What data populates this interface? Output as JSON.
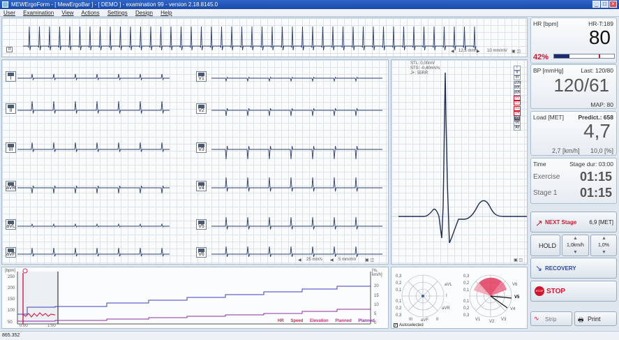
{
  "window": {
    "title": "MEWErgoForm - [ MewErgoBar ] - [ DEMO ] - examination 99 - version 2.18.8145.0",
    "min": "_",
    "max": "□",
    "close": "×"
  },
  "menu": [
    "User",
    "Examination",
    "View",
    "Actions",
    "Settings",
    "Design",
    "Help"
  ],
  "rhythm": {
    "lead": "II",
    "speed": "12,5 mm/s",
    "gain": "10 mm/mV"
  },
  "leads_left": [
    "I",
    "II",
    "III",
    "aVR",
    "aVL",
    "aVF"
  ],
  "leads_right": [
    "V1",
    "V2",
    "V3",
    "V4",
    "V5",
    "V6"
  ],
  "ecg_footer": {
    "speed": "25 mm/s",
    "gain": "5 mm/mV"
  },
  "avg": {
    "stl": "STL: 0,00mV",
    "sts": "STS: -0,40mV/s",
    "jx": "J+: 55RR",
    "leads": [
      "I",
      "II",
      "III",
      "aVR",
      "aVL",
      "aVF",
      "V1",
      "V2",
      "V3",
      "V4",
      "V5",
      "V6",
      "All"
    ]
  },
  "trend": {
    "yleft_unit": "[bpm]",
    "yright_unit": "[%, km/h]",
    "yleft_ticks": [
      "250",
      "200",
      "150",
      "100",
      "50"
    ],
    "yright_ticks": [
      "20",
      "15",
      "10",
      "5",
      "0"
    ],
    "x_ticks": [
      "0:00",
      "1:00"
    ],
    "legend": [
      "HR",
      "Speed",
      "Elevation",
      "Planned",
      "Planned"
    ],
    "legend_colors": [
      "#d6284e",
      "#d6284e",
      "#c62e7a",
      "#3b3ec0",
      "#8a2f9a"
    ]
  },
  "polar": {
    "left_labels": [
      "0,3",
      "0,2",
      "0,1",
      "0,1",
      "0,2",
      "0,3"
    ],
    "right_labels": [
      "0,3",
      "0,2",
      "0,1",
      "0,1",
      "0,2",
      "0,3"
    ],
    "leads_left": [
      "I",
      "aVL",
      "aVR",
      "aVF",
      "III",
      "II"
    ],
    "leads_right": [
      "V1",
      "V2",
      "V3",
      "V4",
      "V5",
      "V6"
    ],
    "autoselected": "Autoselected"
  },
  "hr": {
    "label": "HR [bpm]",
    "target": "HR-T:189",
    "value": "80",
    "percent": "42%"
  },
  "bp": {
    "label": "BP [mmHg]",
    "last": "Last: 120/80",
    "value": "120/61",
    "map": "MAP: 80"
  },
  "load": {
    "label": "Load [MET]",
    "predict": "Predict.: 658",
    "value": "4,7",
    "speed": "2,7 [km/h]",
    "elevation": "10,0 [%]"
  },
  "time": {
    "label": "Time",
    "stage_dur": "Stage dur: 03:00",
    "exercise_label": "Exercise",
    "exercise": "01:15",
    "stage_label": "Stage 1",
    "stage": "01:15"
  },
  "next": {
    "label": "NEXT Stage",
    "met": "6,9 [MET]"
  },
  "hold": {
    "label": "HOLD",
    "speed": "1,0km/h",
    "elev": "1,0%"
  },
  "recovery": {
    "label": "RECOVERY"
  },
  "stop": {
    "label": "STOP",
    "badge": "STOP"
  },
  "strip": {
    "label": "Strip"
  },
  "print": {
    "label": "Print"
  },
  "status": {
    "text": "865.352"
  }
}
